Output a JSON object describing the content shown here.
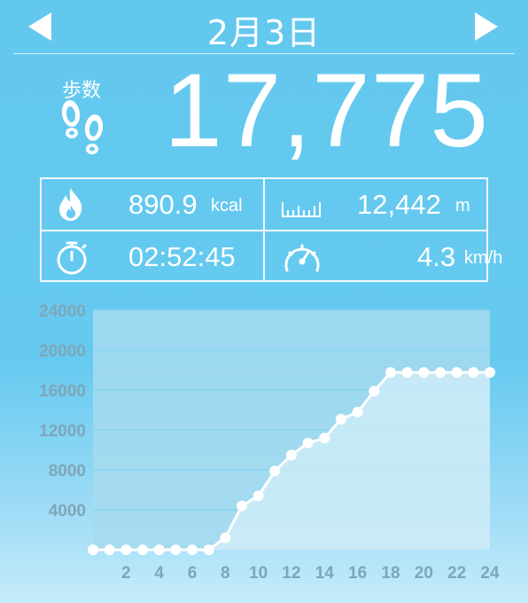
{
  "header": {
    "date": "2月3日",
    "prev_icon": "left-triangle-icon",
    "next_icon": "right-triangle-icon"
  },
  "steps": {
    "label": "歩数",
    "value": "17,775",
    "icon": "footprints-icon"
  },
  "stats": {
    "calories": {
      "value": "890.9",
      "unit": "kcal",
      "icon": "flame-icon"
    },
    "distance": {
      "value": "12,442",
      "unit": "m",
      "icon": "ruler-icon"
    },
    "duration": {
      "value": "02:52:45",
      "icon": "stopwatch-icon"
    },
    "speed": {
      "value": "4.3",
      "unit": "km/h",
      "icon": "speedometer-icon"
    }
  },
  "colors": {
    "background": "#66caf0",
    "text": "#ffffff",
    "plot_area": "#a6dbee",
    "axis_label": "#7fa6b8",
    "line": "#ffffff"
  },
  "chart_data": {
    "type": "area",
    "title": "",
    "xlabel": "",
    "ylabel": "",
    "ylim": [
      0,
      24000
    ],
    "xlim": [
      0,
      24
    ],
    "yticks": [
      "24000",
      "20000",
      "16000",
      "12000",
      "8000",
      "4000"
    ],
    "xticks": [
      "2",
      "4",
      "6",
      "8",
      "10",
      "12",
      "14",
      "16",
      "18",
      "20",
      "22",
      "24"
    ],
    "grid": true,
    "legend": "none",
    "series": [
      {
        "x": [
          0,
          1,
          2,
          3,
          4,
          5,
          6,
          7,
          8,
          9,
          10,
          11,
          12,
          13,
          14,
          15,
          16,
          17,
          18,
          19,
          20,
          21,
          22,
          23,
          24
        ],
        "values": [
          0,
          0,
          0,
          0,
          0,
          0,
          0,
          0,
          1200,
          4400,
          5400,
          7900,
          9500,
          10700,
          11200,
          13100,
          13800,
          15900,
          17775,
          17775,
          17775,
          17775,
          17775,
          17775,
          17775
        ]
      }
    ]
  }
}
